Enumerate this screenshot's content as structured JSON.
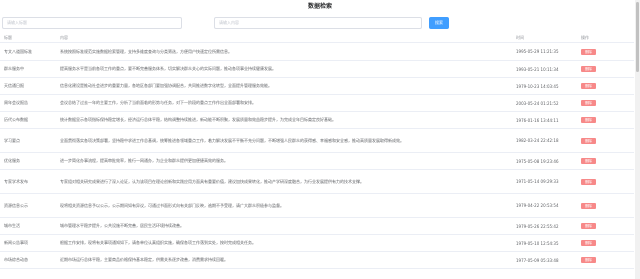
{
  "page": {
    "title": "数据检索"
  },
  "search": {
    "title_placeholder": "请输入标题",
    "content_placeholder": "请输入内容",
    "button_label": "搜索"
  },
  "table": {
    "headers": {
      "title": "标题",
      "content": "内容",
      "time": "时间",
      "op": "操作"
    },
    "delete_label": "删除",
    "rows": [
      {
        "title": "专文八道国标准",
        "content": "系统按照标准规范实施数据检索管理，支持多维度查询与分类筛选，方便用户快速定位所需信息。",
        "time": "1995-05-29 11:21:35"
      },
      {
        "title": "群众服务中",
        "content": "提高服务水平是当前各项工作的重点，要不断完善服务体系，切实解决群众关心的实际问题，推动各项事业持续健康发展。",
        "time": "1993-05-21 10:11:34"
      },
      {
        "title": "天信通日报",
        "content": "信息化建设是推动社会进步的重要力量，各地区各部门要加强协调配合，共同推进数字化转型，全面提升管理服务效能。",
        "time": "1979-10-23 14:03:45"
      },
      {
        "title": "周年会议报告",
        "content": "会议总结了过去一年的主要工作，分析了当前面临的形势与任务，对下一阶段的重点工作作出全面部署和安排。",
        "time": "2003-05-24 01:21:52"
      },
      {
        "title": "历代公布数据",
        "content": "统计数据显示各项指标保持稳定增长，经济运行总体平稳，结构调整持续推进，新动能不断积聚，发展质量和效益稳步提升，为完成全年目标奠定良好基础。",
        "time": "1976-01-16 13:44:11"
      },
      {
        "title": "学习要点",
        "content": "全面贯彻落实各项决策部署，坚持稳中求进工作总基调，统筹推进各领域重点工作，着力解决发展不平衡不充分问题，不断增强人民群众的获得感、幸福感和安全感，推动高质量发展取得新成效。",
        "time": "1982-03-24 22:42:18"
      },
      {
        "title": "优化服务",
        "content": "进一步简化办事流程，提高审批效率，推行一网通办，为企业和群众提供更加便捷高效的服务。",
        "time": "1975-05-08 19:23:46"
      },
      {
        "title": "专家学术发布",
        "content": "专家组对相关研究成果进行了深入论证，认为该项目在理论创新和实践应用方面具有重要价值，建议加快成果转化，推动产学研深度融合，为行业发展提供有力的技术支撑。",
        "time": "1971-05-14 09:29:33"
      },
      {
        "title": "资源信息公示",
        "content": "现将相关资源信息予以公示，公示期间如有异议，可通过书面形式向有关部门反映，逾期不予受理，请广大群众积极参与监督。",
        "time": "1979-04-22 20:53:54"
      },
      {
        "title": "城市生活",
        "content": "城市管理水平稳步提升，公共设施不断完善，居民生活环境持续改善。",
        "time": "1979-05-26 22:55:42"
      },
      {
        "title": "新闻公告事项",
        "content": "根据工作安排，现将有关事项通知如下，请各单位认真组织实施，确保各项工作落到实处，按时完成相关任务。",
        "time": "1979-05-10 12:54:35"
      },
      {
        "title": "市场综合动态",
        "content": "近期市场运行总体平稳，主要商品价格保持基本稳定，供需关系逐步改善，消费需求持续回暖。",
        "time": "1977-05-09 05:33:48"
      }
    ]
  }
}
